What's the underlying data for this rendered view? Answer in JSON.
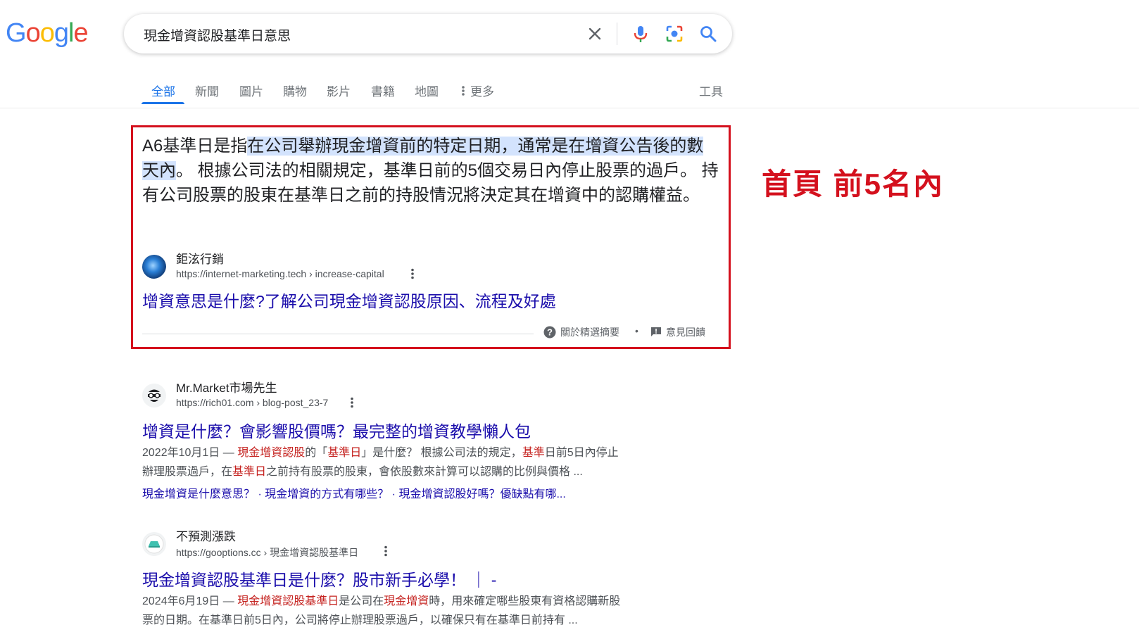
{
  "logo": {
    "letters": [
      "G",
      "o",
      "o",
      "g",
      "l",
      "e"
    ],
    "colors": [
      "#4285f4",
      "#ea4335",
      "#fbbc05",
      "#4285f4",
      "#34a853",
      "#ea4335"
    ]
  },
  "search": {
    "query": "現金增資認股基準日意思"
  },
  "tabs": [
    {
      "label": "全部",
      "active": true
    },
    {
      "label": "新聞"
    },
    {
      "label": "圖片"
    },
    {
      "label": "購物"
    },
    {
      "label": "影片"
    },
    {
      "label": "書籍"
    },
    {
      "label": "地圖"
    },
    {
      "label": "更多"
    }
  ],
  "tools_label": "工具",
  "annotation": "首頁 前5名內",
  "featured_snippet": {
    "text_before": "A6基準日是指",
    "text_highlight": "在公司舉辦現金增資前的特定日期，通常是在增資公告後的數天內",
    "text_after": "。 根據公司法的相關規定，基準日前的5個交易日內停止股票的過戶。 持有公司股票的股東在基準日之前的持股情況將決定其在增資中的認購權益。",
    "site_name": "鉅泫行銷",
    "url": "https://internet-marketing.tech › increase-capital",
    "title": "增資意思是什麼?了解公司現金增資認股原因、流程及好處",
    "about_label": "關於精選摘要",
    "feedback_label": "意見回饋",
    "separator": "•"
  },
  "results": [
    {
      "site_name": "Mr.Market市場先生",
      "url": "https://rich01.com › blog-post_23-7",
      "title": "增資是什麼？會影響股價嗎？最完整的增資教學懶人包",
      "desc_line1": [
        {
          "t": "2022年10月1日 — "
        },
        {
          "t": "現金增資認股",
          "em": true
        },
        {
          "t": "的「"
        },
        {
          "t": "基準日",
          "em": true
        },
        {
          "t": "」是什麼？ 根據公司法的規定，"
        },
        {
          "t": "基準",
          "em": true
        },
        {
          "t": "日前5日內停止"
        }
      ],
      "desc_line2": [
        {
          "t": "辦理股票過戶，在"
        },
        {
          "t": "基準日",
          "em": true
        },
        {
          "t": "之前持有股票的股東，會依股數來計算可以認購的比例與價格 ..."
        }
      ],
      "sitelinks": "現金增資是什麼意思？ · 現金增資的方式有哪些？ · 現金增資認股好嗎？優缺點有哪..."
    },
    {
      "site_name": "不預測漲跌",
      "url": "https://gooptions.cc › 現金增資認股基準日",
      "title": "現金增資認股基準日是什麼？股市新手必學！ ｜ -",
      "desc_line1": [
        {
          "t": "2024年6月19日 — "
        },
        {
          "t": "現金增資認股基準日",
          "em": true
        },
        {
          "t": "是公司在"
        },
        {
          "t": "現金增資",
          "em": true
        },
        {
          "t": "時，用來確定哪些股東有資格認購新股"
        }
      ],
      "desc_line2": [
        {
          "t": "票的日期。在基準日前5日內，公司將停止辦理股票過戶，以確保只有在基準日前持有 ..."
        }
      ]
    }
  ]
}
